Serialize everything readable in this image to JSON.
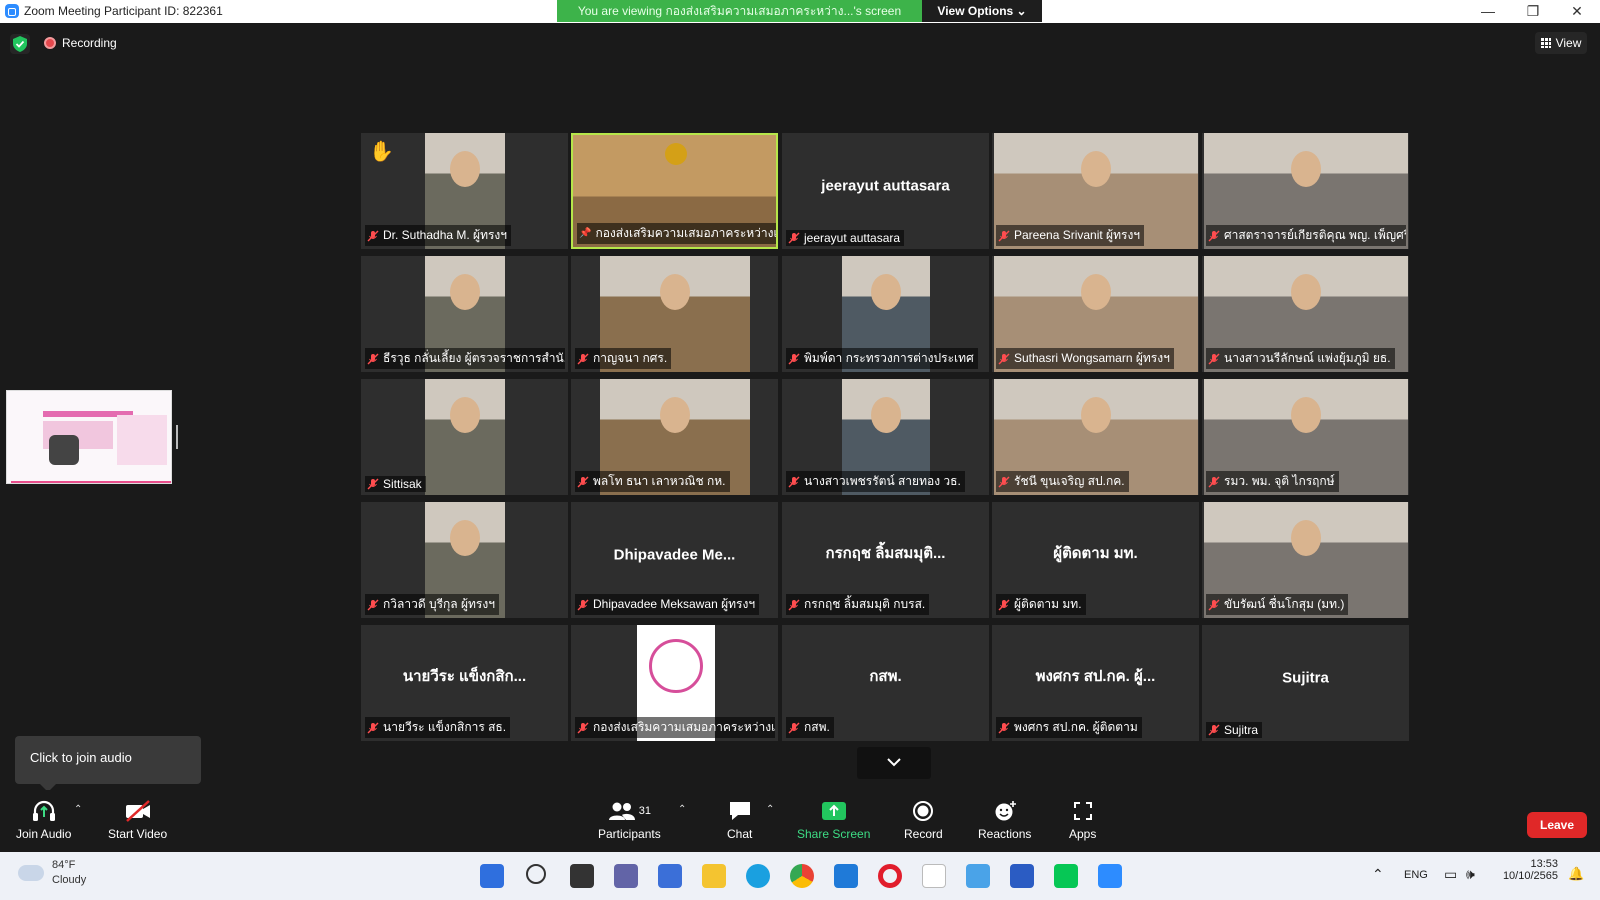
{
  "titlebar": {
    "title": "Zoom Meeting Participant ID: 822361",
    "viewing_banner": "You are viewing กองส่งเสริมความเสมอภาคระหว่าง...'s screen",
    "view_options": "View Options ⌄",
    "minimize": "—",
    "maximize": "❐",
    "close": "✕"
  },
  "status": {
    "recording": "Recording",
    "view_label": "View"
  },
  "gallery": {
    "tiles": [
      {
        "name": "Dr. Suthadha M. ผู้ทรงฯ",
        "center": "",
        "video": true,
        "hand": true
      },
      {
        "name": "กองส่งเสริมความเสมอภาคระหว่างเพศ",
        "center": "",
        "video": true,
        "active": true
      },
      {
        "name": "jeerayut auttasara",
        "center": "jeerayut auttasara",
        "video": false
      },
      {
        "name": "Pareena Srivanit ผู้ทรงฯ",
        "center": "",
        "video": true
      },
      {
        "name": "ศาสตราจารย์เกียรติคุณ พญ. เพ็ญศรี...",
        "center": "",
        "video": true
      },
      {
        "name": "ธีรวุธ กลั่นเลี้ยง ผู้ตรวจราชการสำนั...",
        "center": "",
        "video": true
      },
      {
        "name": "กาญจนา กศร.",
        "center": "",
        "video": true
      },
      {
        "name": "พิมพ์ดา กระทรวงการต่างประเทศ",
        "center": "",
        "video": true
      },
      {
        "name": "Suthasri Wongsamarn ผู้ทรงฯ",
        "center": "",
        "video": true
      },
      {
        "name": "นางสาวนรีลักษณ์ แพ่งยุ้มภูมิ ยธ.",
        "center": "",
        "video": true
      },
      {
        "name": "Sittisak",
        "center": "",
        "video": true
      },
      {
        "name": "พลโท ธนา เลาหวณิช กห.",
        "center": "",
        "video": true
      },
      {
        "name": "นางสาวเพชรรัตน์ สายทอง วธ.",
        "center": "",
        "video": true
      },
      {
        "name": "รัชนี ขุนเจริญ สป.กค.",
        "center": "",
        "video": true
      },
      {
        "name": "รมว. พม. จุติ ไกรฤกษ์",
        "center": "",
        "video": true
      },
      {
        "name": "กวิลาวดี บุรีกุล ผู้ทรงฯ",
        "center": "",
        "video": true
      },
      {
        "name": "Dhipavadee Meksawan ผู้ทรงฯ",
        "center": "Dhipavadee Me...",
        "video": false
      },
      {
        "name": "กรกฤช ลิ้มสมมุติ กบรส.",
        "center": "กรกฤช ลิ้มสมมุติ...",
        "video": false
      },
      {
        "name": "ผู้ติดตาม มท.",
        "center": "ผู้ติดตาม มท.",
        "video": false
      },
      {
        "name": "ขับรัฒน์ ชื่นโกสุม (มท.)",
        "center": "",
        "video": true
      },
      {
        "name": "นายวีระ แข็งกสิการ สธ.",
        "center": "นายวีระ แข็งกสิก...",
        "video": false
      },
      {
        "name": "กองส่งเสริมความเสมอภาคระหว่างเพศ",
        "center": "",
        "video": true,
        "logo": true
      },
      {
        "name": "กสพ.",
        "center": "กสพ.",
        "video": false
      },
      {
        "name": "พงศกร สป.กค. ผู้ติดตาม",
        "center": "พงศกร สป.กค. ผู้...",
        "video": false
      },
      {
        "name": "Sujitra",
        "center": "Sujitra",
        "video": false
      }
    ]
  },
  "audio_tooltip": "Click to join audio",
  "toolbar": {
    "join_audio": "Join Audio",
    "start_video": "Start Video",
    "participants": "Participants",
    "participant_count": "31",
    "chat": "Chat",
    "share_screen": "Share Screen",
    "record": "Record",
    "reactions": "Reactions",
    "apps": "Apps",
    "leave": "Leave"
  },
  "taskbar": {
    "temperature": "84°F",
    "weather": "Cloudy",
    "language": "ENG",
    "time": "13:53",
    "date": "10/10/2565"
  },
  "colors": {
    "accent_green": "#3db34a",
    "leave_red": "#e02828",
    "active_border": "#b6e64a",
    "share_green": "#3ddc84"
  }
}
